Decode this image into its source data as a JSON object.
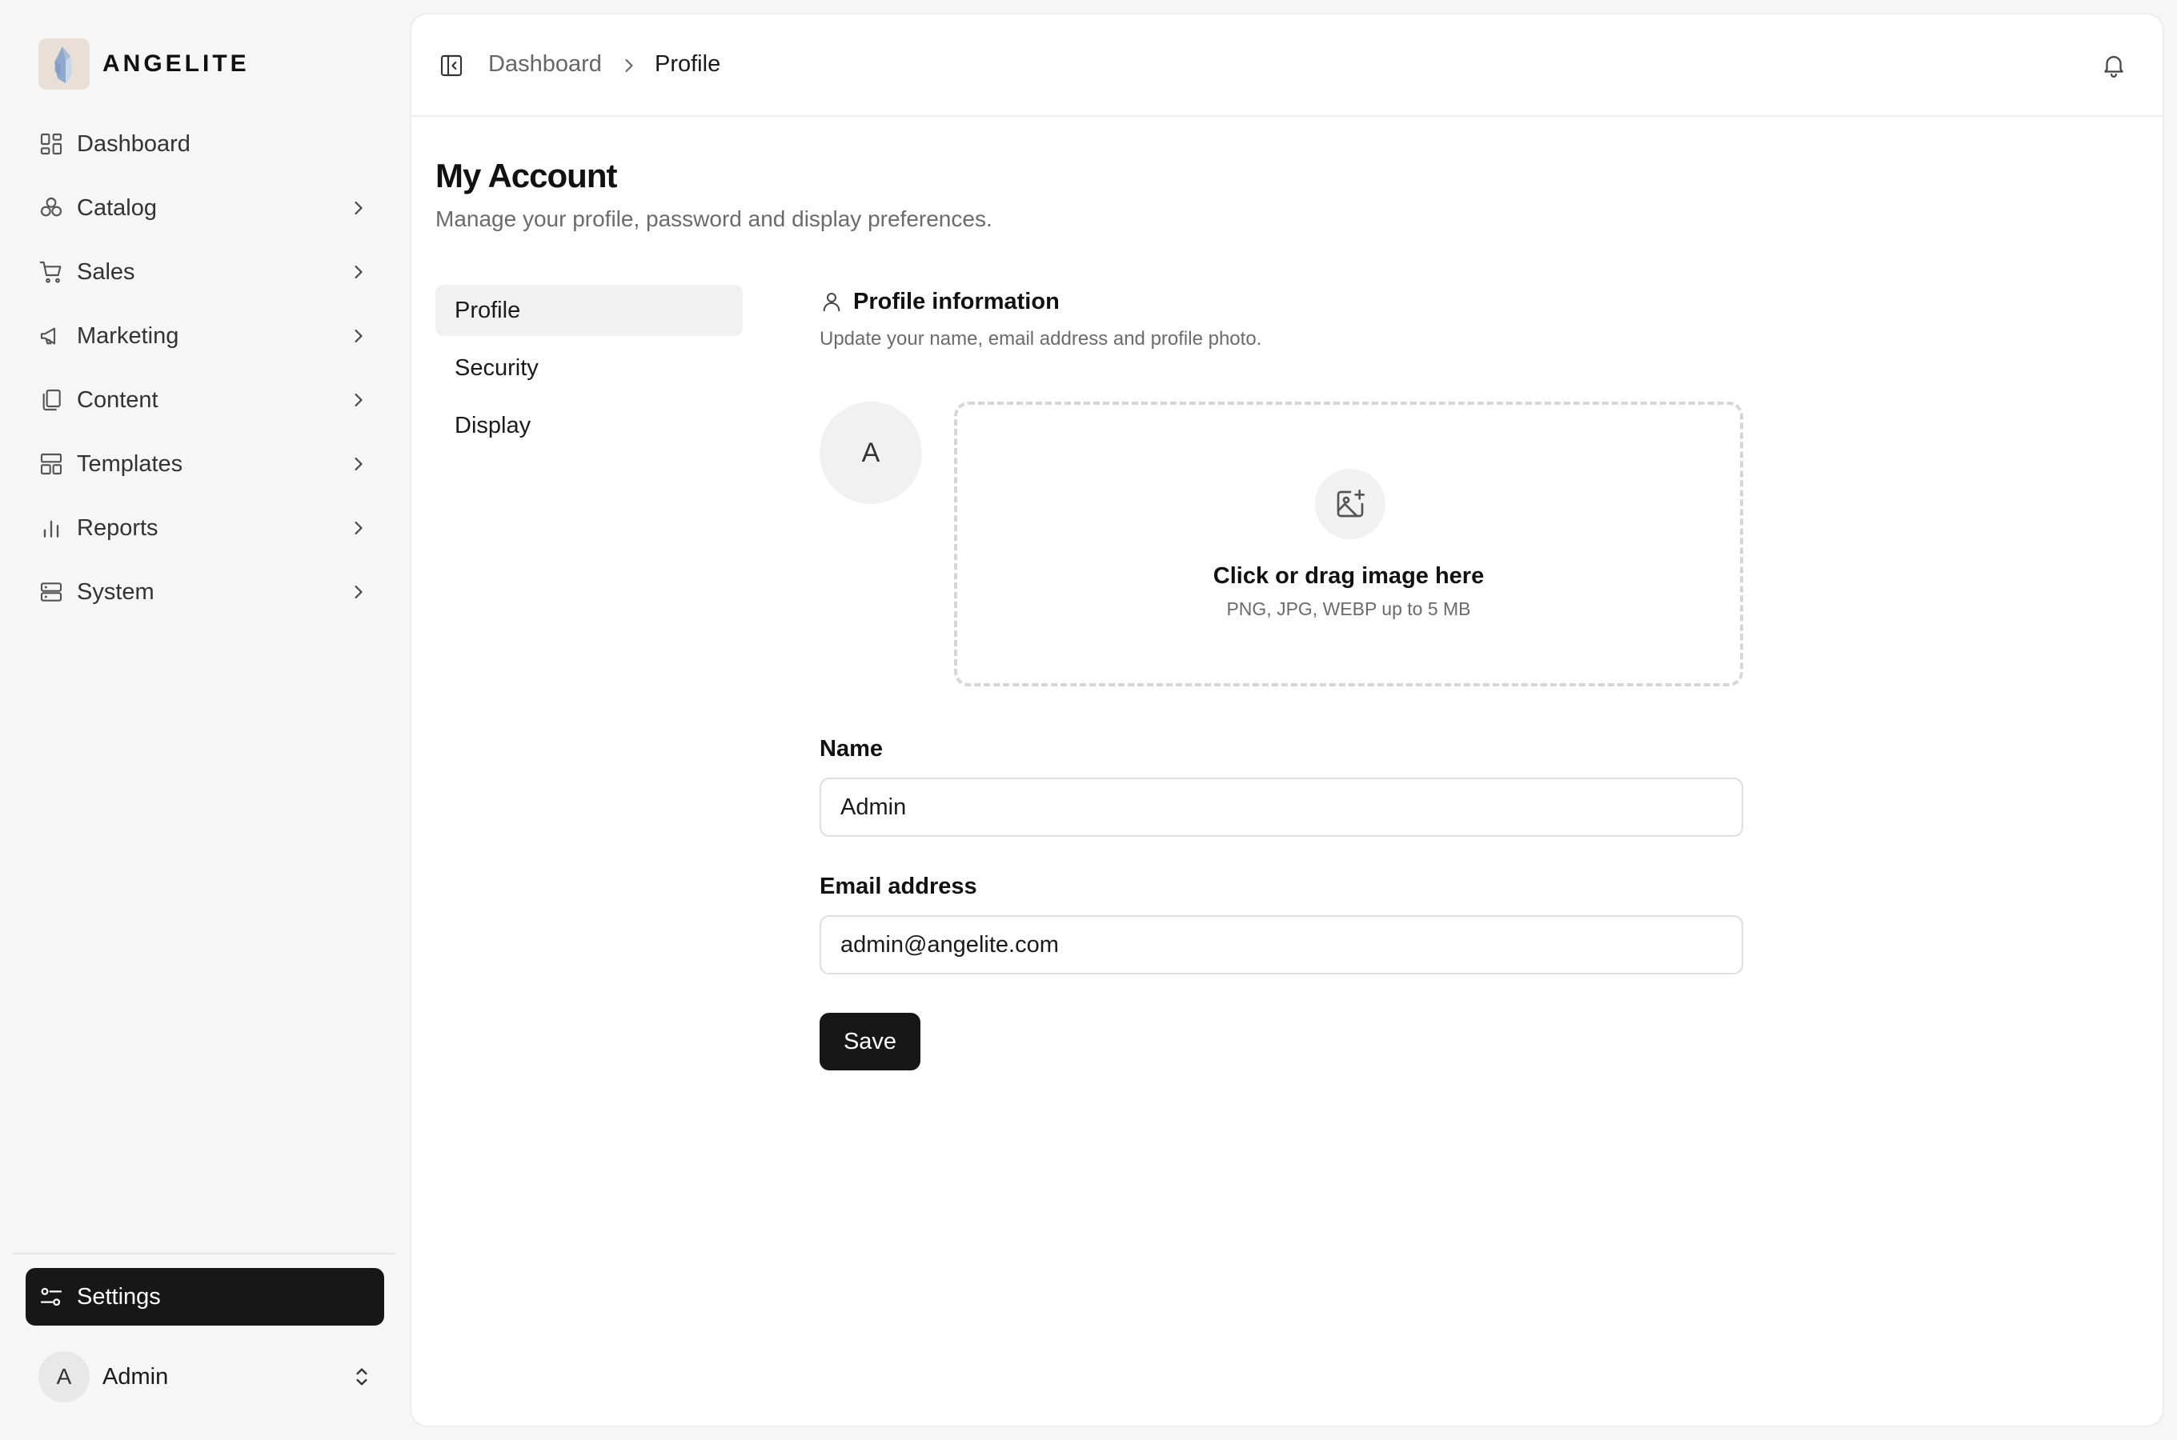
{
  "brand": {
    "name": "ANGELITE",
    "logo_icon": "crystal-logo"
  },
  "sidebar": {
    "items": [
      {
        "label": "Dashboard",
        "icon": "dashboard-icon",
        "has_submenu": false
      },
      {
        "label": "Catalog",
        "icon": "catalog-icon",
        "has_submenu": true
      },
      {
        "label": "Sales",
        "icon": "cart-icon",
        "has_submenu": true
      },
      {
        "label": "Marketing",
        "icon": "megaphone-icon",
        "has_submenu": true
      },
      {
        "label": "Content",
        "icon": "files-icon",
        "has_submenu": true
      },
      {
        "label": "Templates",
        "icon": "layout-icon",
        "has_submenu": true
      },
      {
        "label": "Reports",
        "icon": "bar-chart-icon",
        "has_submenu": true
      },
      {
        "label": "System",
        "icon": "server-icon",
        "has_submenu": true
      }
    ],
    "settings_label": "Settings",
    "user": {
      "initial": "A",
      "name": "Admin"
    }
  },
  "header": {
    "breadcrumb": [
      "Dashboard",
      "Profile"
    ]
  },
  "page": {
    "title": "My Account",
    "subtitle": "Manage your profile, password and display preferences."
  },
  "subnav": {
    "items": [
      {
        "label": "Profile",
        "active": true
      },
      {
        "label": "Security",
        "active": false
      },
      {
        "label": "Display",
        "active": false
      }
    ]
  },
  "profile": {
    "section_title": "Profile information",
    "section_desc": "Update your name, email address and profile photo.",
    "avatar_initial": "A",
    "upload": {
      "title": "Click or drag image here",
      "hint": "PNG, JPG, WEBP up to 5 MB"
    },
    "name_label": "Name",
    "name_value": "Admin",
    "email_label": "Email address",
    "email_value": "admin@angelite.com",
    "save_label": "Save"
  },
  "colors": {
    "primary": "#171717",
    "background": "#f6f6f6",
    "surface": "#ffffff",
    "muted_text": "#6b6b6b",
    "border": "#dedede"
  }
}
